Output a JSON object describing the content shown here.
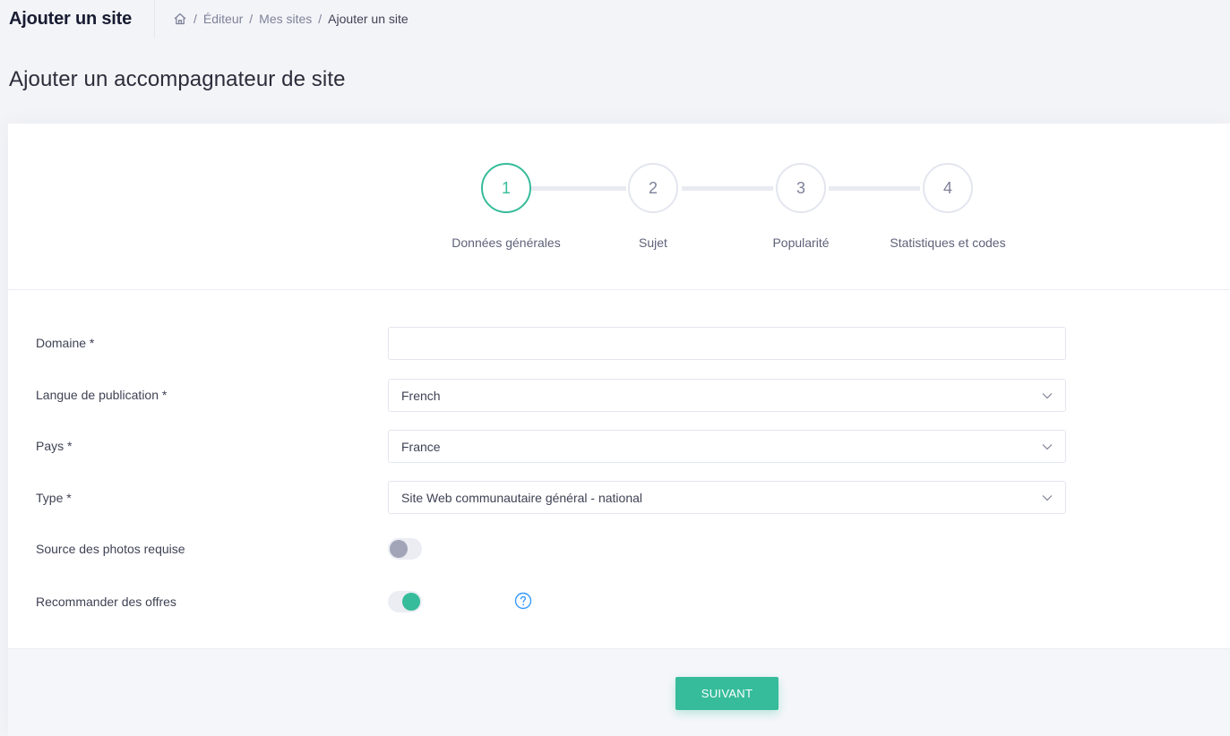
{
  "header": {
    "app_title": "Ajouter un site",
    "breadcrumb": [
      "Éditeur",
      "Mes sites",
      "Ajouter un site"
    ],
    "home_icon": "home-icon"
  },
  "page": {
    "title": "Ajouter un accompagnateur de site"
  },
  "stepper": {
    "steps": [
      {
        "number": "1",
        "label": "Données générales",
        "active": true
      },
      {
        "number": "2",
        "label": "Sujet",
        "active": false
      },
      {
        "number": "3",
        "label": "Popularité",
        "active": false
      },
      {
        "number": "4",
        "label": "Statistiques et codes",
        "active": false
      }
    ]
  },
  "form": {
    "domain": {
      "label": "Domaine *",
      "value": "",
      "placeholder": ""
    },
    "language": {
      "label": "Langue de publication *",
      "value": "French"
    },
    "country": {
      "label": "Pays *",
      "value": "France"
    },
    "type": {
      "label": "Type *",
      "value": "Site Web communautaire général - national"
    },
    "photo_source": {
      "label": "Source des photos requise",
      "enabled": false
    },
    "recommend_offers": {
      "label": "Recommander des offres",
      "enabled": true,
      "help_icon": "help-circle-icon"
    }
  },
  "footer": {
    "next_label": "SUIVANT"
  },
  "colors": {
    "accent": "#36bc9b",
    "help": "#3699ff"
  }
}
